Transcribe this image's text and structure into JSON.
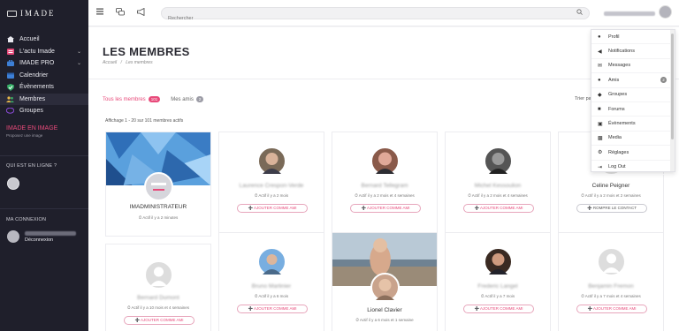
{
  "brand": {
    "name": "IMADE"
  },
  "sidebar": {
    "items": [
      {
        "label": "Accueil",
        "icon": "home-icon"
      },
      {
        "label": "L'actu Imade",
        "icon": "news-icon"
      },
      {
        "label": "IMADE PRO",
        "icon": "briefcase-icon"
      },
      {
        "label": "Calendrier",
        "icon": "calendar-icon"
      },
      {
        "label": "Évènements",
        "icon": "check-badge-icon"
      },
      {
        "label": "Membres",
        "icon": "users-icon"
      },
      {
        "label": "Groupes",
        "icon": "chat-icon"
      }
    ],
    "promo_title": "IMADE EN IMAGE",
    "promo_subtitle": "Proposez une image",
    "online_title": "QUI EST EN LIGNE ?",
    "connection_title": "MA CONNEXION",
    "logout_label": "Déconnexion"
  },
  "topbar": {
    "search_placeholder": "Rechercher"
  },
  "page": {
    "title": "LES MEMBRES",
    "breadcrumb_home": "Accueil",
    "breadcrumb_sep": "/",
    "breadcrumb_current": "Les membres"
  },
  "tabs": [
    {
      "label": "Tous les membres",
      "count": "101"
    },
    {
      "label": "Mes amis",
      "count": "2"
    }
  ],
  "sort_label": "Trier par :",
  "count_text": "Affichage 1 - 20 sur 101 membres actifs",
  "members": [
    {
      "name": "IMADMINISTRATEUR",
      "activity": "Actif il y a 2 minutes",
      "button": ""
    },
    {
      "name": "Laurence Crespon-Verde",
      "activity": "Actif il y a 2 mois",
      "button": "AJOUTER COMME AMI"
    },
    {
      "name": "Bernard Tellegram",
      "activity": "Actif il y a 2 mois et 4 semaines",
      "button": "AJOUTER COMME AMI"
    },
    {
      "name": "Michel Kessoulion",
      "activity": "Actif il y a 2 mois et 4 semaines",
      "button": "AJOUTER COMME AMI"
    },
    {
      "name": "Celine Peigner",
      "activity": "Actif il y a 2 mois et 2 semaines",
      "button": "ROMPRE LE CONTACT"
    },
    {
      "name": "Bernard Dumont",
      "activity": "Actif il y a 10 mois et 4 semaines",
      "button": "AJOUTER COMME AMI"
    },
    {
      "name": "Bruno Martinier",
      "activity": "Actif il y a 6 mois",
      "button": "AJOUTER COMME AMI"
    },
    {
      "name": "Lionel Clavier",
      "activity": "Actif il y a 6 mois et 1 semaine",
      "button": ""
    },
    {
      "name": "Frederic Langel",
      "activity": "Actif il y a 7 mois",
      "button": "AJOUTER COMME AMI"
    },
    {
      "name": "Benjamin Fremon",
      "activity": "Actif il y a 7 mois et 4 semaines",
      "button": "AJOUTER COMME AMI"
    }
  ],
  "dropdown": [
    {
      "label": "Profil",
      "icon": "user-icon",
      "count": ""
    },
    {
      "label": "Notifications",
      "icon": "megaphone-icon",
      "count": ""
    },
    {
      "label": "Messages",
      "icon": "envelope-icon",
      "count": ""
    },
    {
      "label": "Amis",
      "icon": "friends-icon",
      "count": "2"
    },
    {
      "label": "Groupes",
      "icon": "groups-icon",
      "count": ""
    },
    {
      "label": "Forums",
      "icon": "forum-icon",
      "count": ""
    },
    {
      "label": "Évènements",
      "icon": "calendar-icon",
      "count": ""
    },
    {
      "label": "Media",
      "icon": "media-icon",
      "count": ""
    },
    {
      "label": "Réglages",
      "icon": "gear-icon",
      "count": ""
    },
    {
      "label": "Log Out",
      "icon": "logout-icon",
      "count": ""
    }
  ],
  "colors": {
    "accent": "#e84a7a",
    "sidebar": "#1f1f2b"
  }
}
